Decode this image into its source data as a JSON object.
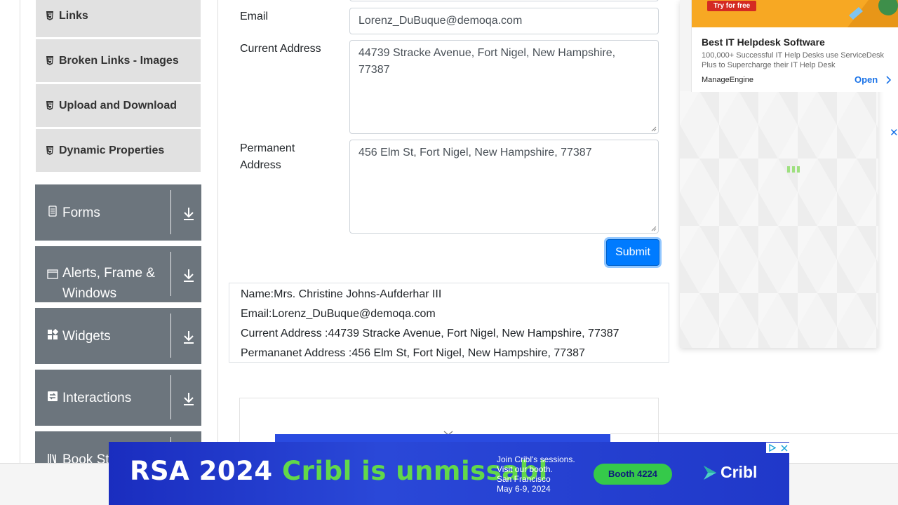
{
  "sidebar": {
    "sub_items": [
      {
        "label": "Links"
      },
      {
        "label": "Broken Links - Images"
      },
      {
        "label": "Upload and Download"
      },
      {
        "label": "Dynamic Properties"
      }
    ],
    "groups": [
      {
        "label": "Forms"
      },
      {
        "label": "Alerts, Frame & Windows"
      },
      {
        "label": "Widgets"
      },
      {
        "label": "Interactions"
      },
      {
        "label": "Book Store Application"
      }
    ]
  },
  "form": {
    "email_label": "Email",
    "email_value": "Lorenz_DuBuque@demoqa.com",
    "current_address_label": "Current Address",
    "current_address_value": "44739 Stracke Avenue, Fort Nigel, New Hampshire, 77387",
    "permanent_address_label": "Permanent Address",
    "permanent_address_value": "456 Elm St, Fort Nigel, New Hampshire, 77387",
    "submit_label": "Submit"
  },
  "output": {
    "name": "Name:Mrs. Christine Johns-Aufderhar III",
    "email": "Email:Lorenz_DuBuque@demoqa.com",
    "current_address": "Current Address :44739 Stracke Avenue, Fort Nigel, New Hampshire, 77387",
    "permanent_address": "Permananet Address :456 Elm St, Fort Nigel, New Hampshire, 77387"
  },
  "ad_right": {
    "cta": "Try for free",
    "title": "Best IT Helpdesk Software",
    "description": "100,000+ Successful IT Help Desks use ServiceDesk Plus to Supercharge their IT Help Desk",
    "brand": "ManageEngine",
    "open_label": "Open",
    "close_symbol": "✕"
  },
  "ad_bottom": {
    "headline_white": "RSA 2024 ",
    "headline_green": "Cribl is unmissabl",
    "info_lines": [
      "Join Cribl's sessions.",
      "Visit our booth.",
      "San Francisco",
      "May 6-9, 2024"
    ],
    "booth": "Booth 4224",
    "logo": "Cribl"
  },
  "colors": {
    "primary": "#007bff",
    "sidebar_group": "#6c757d",
    "sidebar_item": "#e1e1e1",
    "ad_orange": "#f7a823",
    "ad_blue": "#2a48d8",
    "ad_green": "#62d84a"
  }
}
